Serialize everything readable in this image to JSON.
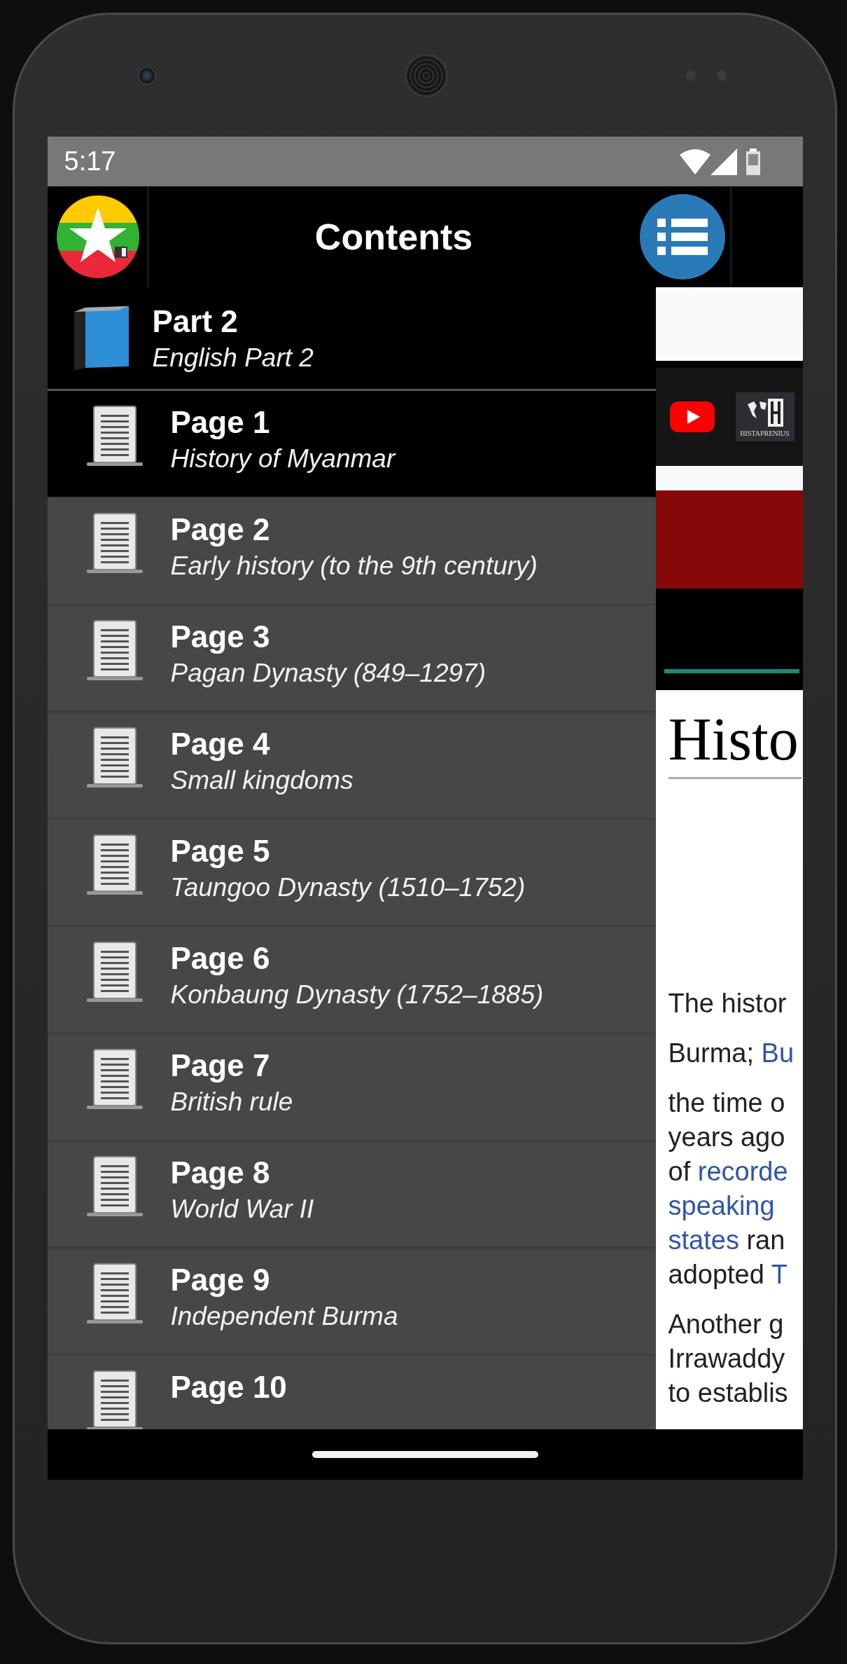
{
  "status_bar": {
    "time": "5:17"
  },
  "app_bar": {
    "title": "Contents"
  },
  "drawer": {
    "part": {
      "title": "Part 2",
      "subtitle": "English Part 2"
    },
    "pages": [
      {
        "title": "Page 1",
        "subtitle": "History of Myanmar",
        "selected": true
      },
      {
        "title": "Page 2",
        "subtitle": "Early history (to the 9th century)",
        "selected": false
      },
      {
        "title": "Page 3",
        "subtitle": "Pagan Dynasty (849–1297)",
        "selected": false
      },
      {
        "title": "Page 4",
        "subtitle": "Small kingdoms",
        "selected": false
      },
      {
        "title": "Page 5",
        "subtitle": "Taungoo Dynasty (1510–1752)",
        "selected": false
      },
      {
        "title": "Page 6",
        "subtitle": "Konbaung Dynasty (1752–1885)",
        "selected": false
      },
      {
        "title": "Page 7",
        "subtitle": "British rule",
        "selected": false
      },
      {
        "title": "Page 8",
        "subtitle": "World War II",
        "selected": false
      },
      {
        "title": "Page 9",
        "subtitle": "Independent Burma",
        "selected": false
      },
      {
        "title": "Page 10",
        "selected": false
      }
    ]
  },
  "web_page": {
    "logo_text": "HISTAPRENIUS",
    "heading": "Histo",
    "paragraphs": [
      [
        [
          {
            "text": "The histor",
            "link": false
          }
        ]
      ],
      [
        [
          {
            "text": "Burma; ",
            "link": false
          },
          {
            "text": "Bu",
            "link": true
          }
        ]
      ],
      [
        [
          {
            "text": "the time o",
            "link": false
          }
        ],
        [
          {
            "text": "years ago",
            "link": false
          }
        ],
        [
          {
            "text": "of ",
            "link": false
          },
          {
            "text": "recorde",
            "link": true
          }
        ],
        [
          {
            "text": "speaking",
            "link": true
          }
        ],
        [
          {
            "text": "states",
            "link": true
          },
          {
            "text": " ran",
            "link": false
          }
        ],
        [
          {
            "text": "adopted ",
            "link": false
          },
          {
            "text": "T",
            "link": true
          }
        ]
      ],
      [
        [
          {
            "text": "Another g",
            "link": false
          }
        ],
        [
          {
            "text": "Irrawaddy",
            "link": false
          }
        ],
        [
          {
            "text": "to establis",
            "link": false
          }
        ]
      ]
    ]
  }
}
